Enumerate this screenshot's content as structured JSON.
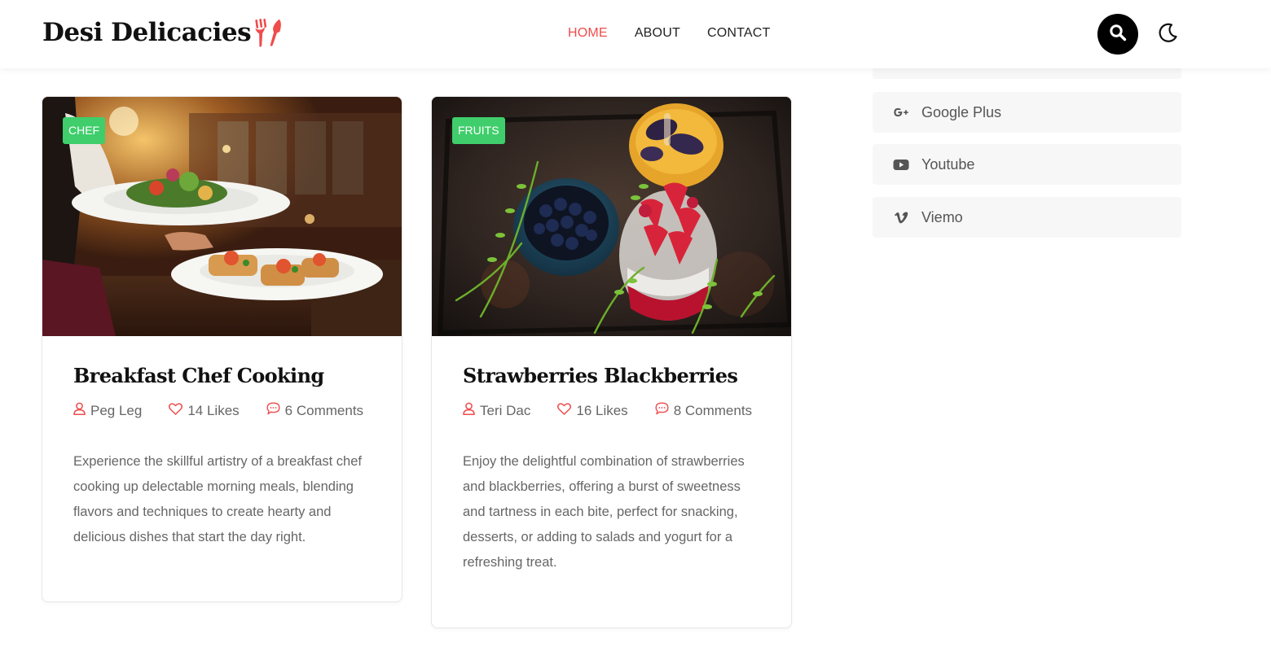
{
  "site": {
    "logo_text": "Desi Delicacies",
    "logo_icon": "fork-knife-icon",
    "accent_color": "#ef4c4c",
    "badge_color": "#3fce6b"
  },
  "nav": {
    "items": [
      {
        "label": "HOME",
        "active": true
      },
      {
        "label": "ABOUT",
        "active": false
      },
      {
        "label": "CONTACT",
        "active": false
      }
    ]
  },
  "header_actions": {
    "search_icon": "search-icon",
    "theme_icon": "moon-icon"
  },
  "posts": [
    {
      "category": "CHEF",
      "title": "Breakfast Chef Cooking",
      "author": "Peg Leg",
      "likes": "14 Likes",
      "comments": "6 Comments",
      "excerpt": "Experience the skillful artistry of a breakfast chef cooking up delectable morning meals, blending flavors and techniques to create hearty and delicious dishes that start the day right."
    },
    {
      "category": "FRUITS",
      "title": "Strawberries Blackberries",
      "author": "Teri Dac",
      "likes": "16 Likes",
      "comments": "8 Comments",
      "excerpt": "Enjoy the delightful combination of strawberries and blackberries, offering a burst of sweetness and tartness in each bite, perfect for snacking, desserts, or adding to salads and yogurt for a refreshing treat."
    }
  ],
  "social": {
    "items": [
      {
        "label": "Google Plus",
        "icon": "google-plus-icon"
      },
      {
        "label": "Youtube",
        "icon": "youtube-icon"
      },
      {
        "label": "Viemo",
        "icon": "vimeo-icon"
      }
    ]
  }
}
